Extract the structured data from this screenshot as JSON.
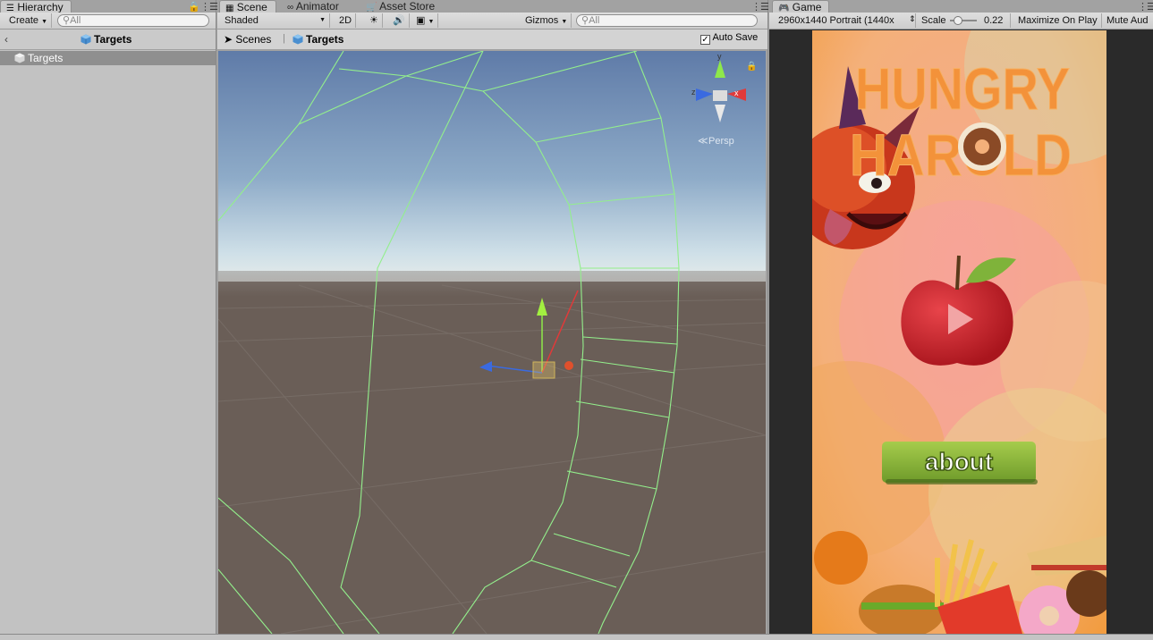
{
  "colors": {
    "panel_bg": "#c2c2c2",
    "selection": "#8f8f8f",
    "wireframe": "#8fe88a",
    "sky_top": "#6a86b0",
    "ground": "#6b5f58",
    "game_orange": "#f3923a",
    "about_green": "#8cb33a"
  },
  "hierarchy": {
    "tab_label": "Hierarchy",
    "create_label": "Create",
    "search_placeholder": "All",
    "scene_title": "Targets",
    "items": [
      "Targets"
    ]
  },
  "scene": {
    "tabs": [
      {
        "label": "Scene",
        "icon": "grid-icon"
      },
      {
        "label": "Animator",
        "icon": "animator-icon"
      },
      {
        "label": "Asset Store",
        "icon": "store-icon"
      }
    ],
    "shading_mode": "Shaded",
    "mode_2d": "2D",
    "gizmos_label": "Gizmos",
    "search_placeholder": "All",
    "breadcrumb_root": "Scenes",
    "breadcrumb_current": "Targets",
    "auto_save_label": "Auto Save",
    "auto_save_checked": true,
    "projection_label": "Persp",
    "gizmo_axes": {
      "y": "y",
      "x": "x",
      "z": "z"
    }
  },
  "game": {
    "tab_label": "Game",
    "resolution": "2960x1440 Portrait (1440x",
    "scale_label": "Scale",
    "scale_value": "0.22",
    "maximize_label": "Maximize On Play",
    "mute_label": "Mute Aud",
    "title_line1": "HUNGRY",
    "title_line2": "HAROLD",
    "about_label": "about"
  }
}
